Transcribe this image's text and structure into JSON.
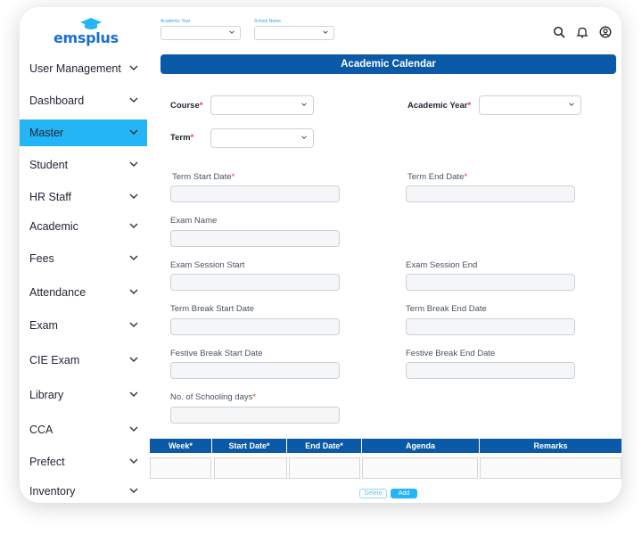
{
  "brand": {
    "logo_text": "emsplus"
  },
  "topbar": {
    "academic_year_label": "Academic Year",
    "school_name_label": "School Name",
    "academic_year_value": "",
    "school_name_value": ""
  },
  "sidebar": {
    "items": [
      {
        "label": "User Management"
      },
      {
        "label": "Dashboard"
      },
      {
        "label": "Master",
        "active": true
      },
      {
        "label": "Student"
      },
      {
        "label": "HR Staff"
      },
      {
        "label": "Academic"
      },
      {
        "label": "Fees"
      },
      {
        "label": "Attendance"
      },
      {
        "label": "Exam"
      },
      {
        "label": "CIE Exam"
      },
      {
        "label": "Library"
      },
      {
        "label": "CCA"
      },
      {
        "label": "Prefect"
      },
      {
        "label": "Inventory"
      }
    ]
  },
  "page": {
    "title": "Academic Calendar"
  },
  "form": {
    "course_label": "Course",
    "academic_year_label": "Academic Year",
    "term_label": "Term",
    "required_mark": "*",
    "term_start_label": "Term Start Date",
    "term_end_label": "Term End Date",
    "exam_name_label": "Exam Name",
    "exam_session_start_label": "Exam Session Start",
    "exam_session_end_label": "Exam Session End",
    "term_break_start_label": "Term Break Start Date",
    "term_break_end_label": "Term Break End Date",
    "festive_break_start_label": "Festive Break Start Date",
    "festive_break_end_label": "Festive Break End Date",
    "schooling_days_label": "No. of Schooling days"
  },
  "table": {
    "headers": [
      "Week*",
      "Start Date*",
      "End Date*",
      "Agenda",
      "Remarks"
    ]
  },
  "actions": {
    "delete_label": "Delete",
    "add_label": "Add"
  },
  "colors": {
    "primary": "#0a5aa8",
    "accent": "#23b5f5",
    "required": "#e23a3a"
  }
}
